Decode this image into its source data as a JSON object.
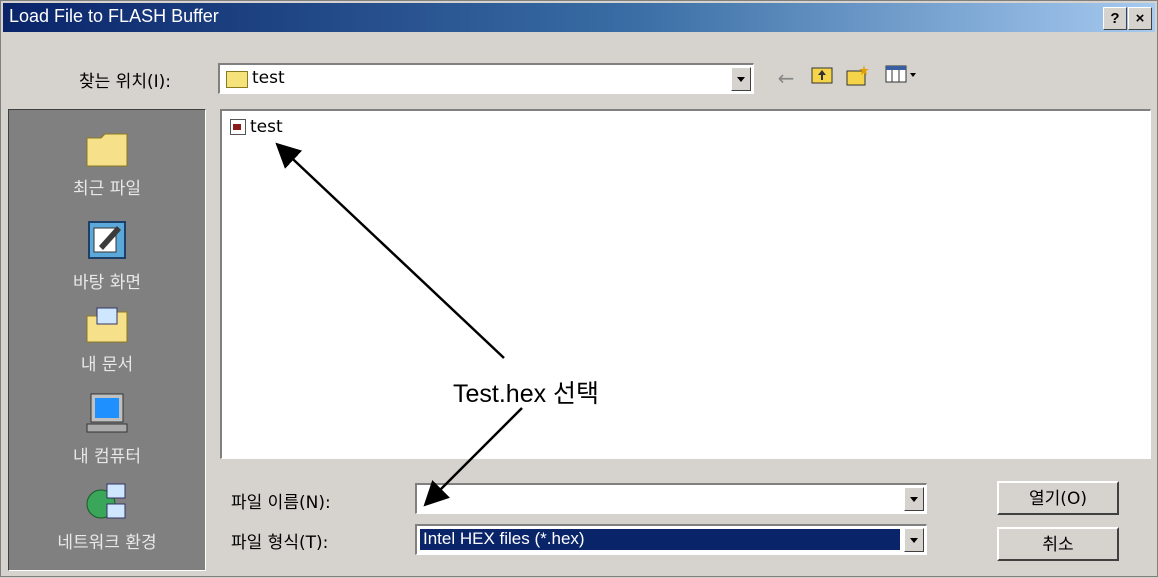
{
  "window": {
    "title": "Load File to FLASH Buffer",
    "help_label": "?",
    "close_label": "×"
  },
  "lookin": {
    "label": "찾는 위치(I):",
    "value": "test"
  },
  "toolbar": {
    "back_icon": "back-arrow-icon",
    "up_icon": "up-folder-icon",
    "newfolder_icon": "new-folder-icon",
    "view_icon": "view-menu-icon"
  },
  "places": [
    {
      "label": "최근 파일",
      "icon": "recent-folder-icon"
    },
    {
      "label": "바탕 화면",
      "icon": "desktop-icon"
    },
    {
      "label": "내 문서",
      "icon": "my-documents-icon"
    },
    {
      "label": "내 컴퓨터",
      "icon": "my-computer-icon"
    },
    {
      "label": "네트워크 환경",
      "icon": "network-icon"
    }
  ],
  "files": [
    {
      "name": "test"
    }
  ],
  "filename": {
    "label": "파일 이름(N):",
    "value": ""
  },
  "filetype": {
    "label": "파일 형식(T):",
    "value": "Intel HEX files (*.hex)"
  },
  "buttons": {
    "open_label": "열기(O)",
    "cancel_label": "취소"
  },
  "annotation": {
    "text": "Test.hex 선택"
  }
}
